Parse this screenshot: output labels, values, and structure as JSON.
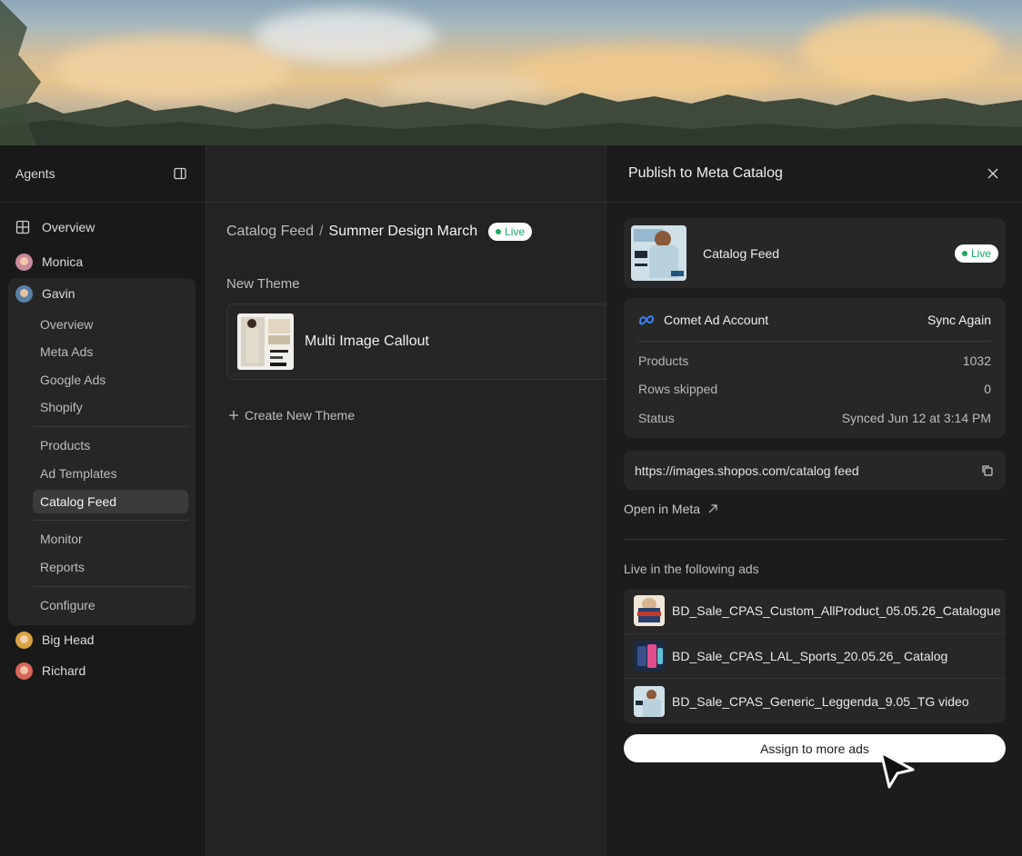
{
  "sidebar": {
    "title": "Agents",
    "toggle_icon": "sidebar-toggle-icon",
    "overview": "Overview",
    "agents": [
      {
        "name": "Monica",
        "avatar_color": "#c98a9b"
      },
      {
        "name": "Gavin",
        "avatar_color": "#5b7fa8"
      },
      {
        "name": "Big Head",
        "avatar_color": "#d9a441"
      },
      {
        "name": "Richard",
        "avatar_color": "#d9655a"
      }
    ],
    "gavin_items": {
      "overview": "Overview",
      "meta_ads": "Meta Ads",
      "google_ads": "Google Ads",
      "shopify": "Shopify",
      "products": "Products",
      "ad_templates": "Ad Templates",
      "catalog_feed": "Catalog Feed",
      "monitor": "Monitor",
      "reports": "Reports",
      "configure": "Configure"
    },
    "active_item": "Catalog Feed"
  },
  "main": {
    "breadcrumb_root": "Catalog Feed",
    "breadcrumb_sep": "/",
    "breadcrumb_current": "Summer Design March",
    "status": "Live",
    "section_label": "New Theme",
    "theme_name": "Multi Image Callout",
    "create_label": "Create New Theme"
  },
  "panel": {
    "title": "Publish to Meta Catalog",
    "feed_name": "Catalog Feed",
    "feed_status": "Live",
    "account_name": "Comet Ad Account",
    "sync_label": "Sync Again",
    "stats": {
      "products_label": "Products",
      "products_value": "1032",
      "rows_label": "Rows skipped",
      "rows_value": "0",
      "status_label": "Status",
      "status_value": "Synced Jun 12 at 3:14 PM"
    },
    "url": "https://images.shopos.com/catalog feed",
    "open_label": "Open in Meta",
    "ads_label": "Live in the following ads",
    "ads": [
      "BD_Sale_CPAS_Custom_AllProduct_05.05.26_Catalogue",
      "BD_Sale_CPAS_LAL_Sports_20.05.26_ Catalog",
      "BD_Sale_CPAS_Generic_Leggenda_9.05_TG video"
    ],
    "assign_label": "Assign to more ads"
  },
  "colors": {
    "accent_live": "#1aa760",
    "panel_bg": "#1c1c1c",
    "sidebar_bg": "#191919"
  }
}
